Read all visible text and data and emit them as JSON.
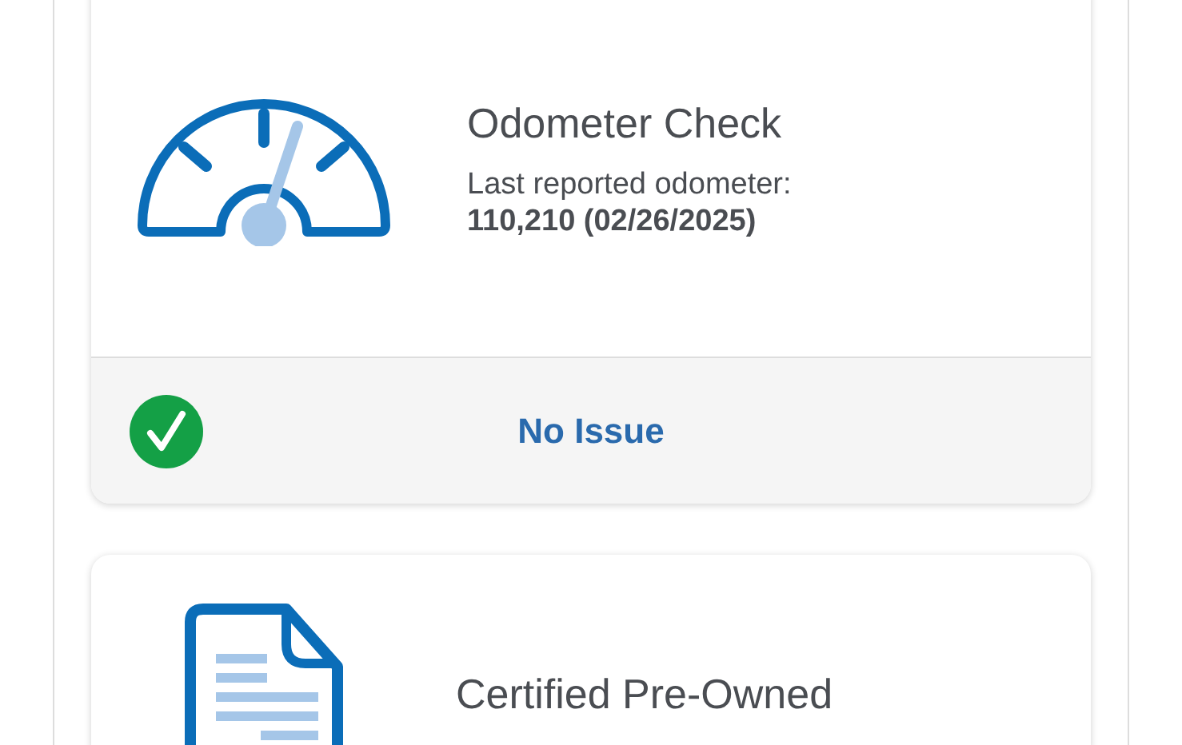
{
  "cards": [
    {
      "kind": "odometer",
      "title": "Odometer Check",
      "details": [
        {
          "kind": "label",
          "text": "Last reported odometer:"
        },
        {
          "kind": "value",
          "text": "110,210 (02/26/2025)"
        }
      ],
      "status": {
        "kind": "ok",
        "text": "No Issue"
      }
    },
    {
      "kind": "certification",
      "title": "Certified Pre-Owned"
    }
  ]
}
